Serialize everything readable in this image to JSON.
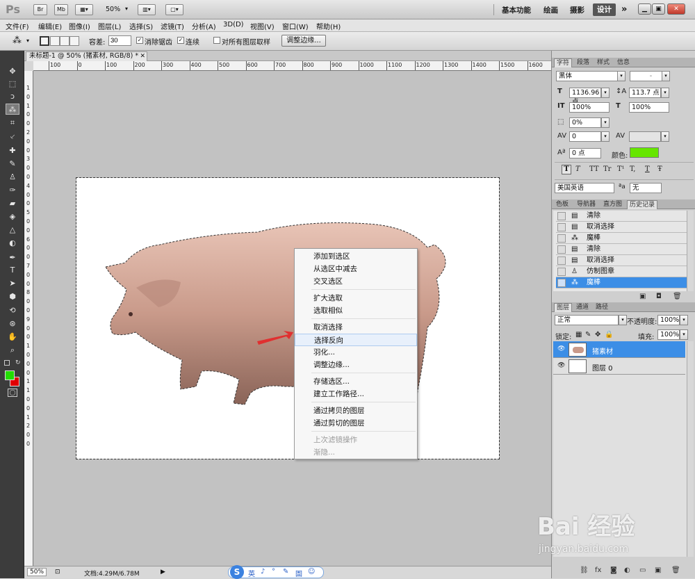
{
  "appbar": {
    "logo": "Ps",
    "btn_br": "Br",
    "btn_mb": "Mb",
    "zoom": "50%",
    "workspaces": [
      "基本功能",
      "绘画",
      "摄影",
      "设计"
    ],
    "active_workspace": "设计",
    "more": "»"
  },
  "menu": [
    "文件(F)",
    "编辑(E)",
    "图像(I)",
    "图层(L)",
    "选择(S)",
    "滤镜(T)",
    "分析(A)",
    "3D(D)",
    "视图(V)",
    "窗口(W)",
    "帮助(H)"
  ],
  "options": {
    "tolerance_label": "容差:",
    "tolerance_value": "30",
    "antialias_label": "消除锯齿",
    "contiguous_label": "连续",
    "sample_all_label": "对所有图层取样",
    "refine_edge_button": "调整边缘..."
  },
  "document": {
    "tab_title": "未标题-1 @ 50% (猪素材, RGB/8) *",
    "ruler_h": [
      "100",
      "0",
      "100",
      "200",
      "300",
      "400",
      "500",
      "600",
      "700",
      "800",
      "900",
      "1000",
      "1100",
      "1200",
      "1300",
      "1400",
      "1500",
      "1600"
    ],
    "ruler_v": [
      "1",
      "0",
      "1",
      "0",
      "0",
      "2",
      "0",
      "0",
      "3",
      "0",
      "0",
      "4",
      "0",
      "0",
      "5",
      "0",
      "0",
      "6",
      "0",
      "0",
      "7",
      "0",
      "0",
      "8",
      "0",
      "0",
      "9",
      "0",
      "0",
      "1",
      "0",
      "0",
      "0",
      "1",
      "1",
      "0",
      "0",
      "1",
      "2",
      "0",
      "0"
    ]
  },
  "status": {
    "zoom": "50%",
    "doc_info": "文档:4.29M/6.78M"
  },
  "context_menu": {
    "items": [
      "添加到选区",
      "从选区中减去",
      "交叉选区",
      "扩大选取",
      "选取相似",
      "取消选择",
      "选择反向",
      "羽化...",
      "调整边缘...",
      "存储选区...",
      "建立工作路径...",
      "通过拷贝的图层",
      "通过剪切的图层",
      "上次滤镜操作",
      "渐隐..."
    ],
    "highlighted": "选择反向"
  },
  "char_panel": {
    "tabs": [
      "字符",
      "段落",
      "样式",
      "信息"
    ],
    "font": "黑体",
    "font_style": "-",
    "size": "1136.96 点",
    "leading": "113.7 点",
    "vscale": "100%",
    "hscale": "100%",
    "tsume": "0%",
    "kerning": "0",
    "baseline": "0 点",
    "color_label": "颜色:",
    "text_color": "#66e600",
    "language": "美国英语",
    "aa_label": "a",
    "aa_value": "无",
    "styles": [
      "T",
      "T",
      "TT",
      "Tr",
      "T¹",
      "T,",
      "T",
      "Ŧ"
    ]
  },
  "history_panel": {
    "tabs": [
      "色板",
      "导航器",
      "直方图",
      "历史记录"
    ],
    "items": [
      "清除",
      "取消选择",
      "魔棒",
      "清除",
      "取消选择",
      "仿制图章",
      "魔棒"
    ],
    "selected_index": 6
  },
  "layers_panel": {
    "tabs": [
      "图层",
      "通道",
      "路径"
    ],
    "blend_mode": "正常",
    "opacity_label": "不透明度:",
    "opacity": "100%",
    "lock_label": "锁定:",
    "fill_label": "填充:",
    "fill": "100%",
    "layers": [
      "猪素材",
      "图层 0"
    ],
    "selected": "猪素材"
  },
  "ime": {
    "items": [
      "英",
      "♪",
      "°",
      "✎",
      "圄",
      "☺"
    ]
  },
  "watermark": {
    "brand": "Bai 经验",
    "url": "jingyan.baidu.com"
  },
  "colors": {
    "foreground": "#22dd00",
    "background": "#e00000"
  }
}
